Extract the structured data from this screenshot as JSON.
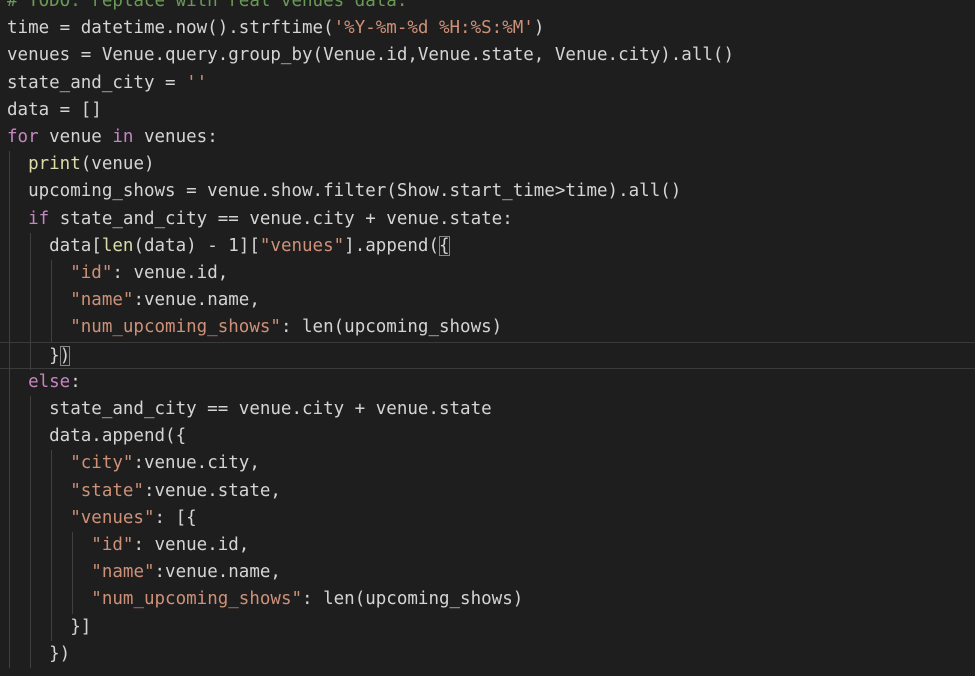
{
  "editor": {
    "lines": [
      [
        {
          "t": "# TODO: replace with real venues data.",
          "c": "cmt"
        }
      ],
      [
        {
          "t": "time = datetime.now().strftime(",
          "c": "var"
        },
        {
          "t": "'%Y-%m-%d %H:%S:%M'",
          "c": "str"
        },
        {
          "t": ")",
          "c": "var"
        }
      ],
      [
        {
          "t": "venues = Venue.query.group_by(Venue.id,Venue.state, Venue.city).all()",
          "c": "var"
        }
      ],
      [
        {
          "t": "state_and_city = ",
          "c": "var"
        },
        {
          "t": "''",
          "c": "str"
        }
      ],
      [
        {
          "t": "data = []",
          "c": "var"
        }
      ],
      [
        {
          "t": "for",
          "c": "kw"
        },
        {
          "t": " venue ",
          "c": "var"
        },
        {
          "t": "in",
          "c": "kw"
        },
        {
          "t": " venues:",
          "c": "var"
        }
      ],
      [
        {
          "t": "  ",
          "c": "var"
        },
        {
          "t": "print",
          "c": "fn"
        },
        {
          "t": "(venue)",
          "c": "var"
        }
      ],
      [
        {
          "t": "  upcoming_shows = venue.show.filter(Show.start_time>time).all()",
          "c": "var"
        }
      ],
      [
        {
          "t": "  ",
          "c": "var"
        },
        {
          "t": "if",
          "c": "kw"
        },
        {
          "t": " state_and_city == venue.city + venue.state:",
          "c": "var"
        }
      ],
      [
        {
          "t": "    data[",
          "c": "var"
        },
        {
          "t": "len",
          "c": "fn"
        },
        {
          "t": "(data) - 1][",
          "c": "var"
        },
        {
          "t": "\"venues\"",
          "c": "str"
        },
        {
          "t": "].append(",
          "c": "var"
        },
        {
          "t": "{",
          "c": "var",
          "m": true
        }
      ],
      [
        {
          "t": "      ",
          "c": "var"
        },
        {
          "t": "\"id\"",
          "c": "str"
        },
        {
          "t": ": venue.id,",
          "c": "var"
        }
      ],
      [
        {
          "t": "      ",
          "c": "var"
        },
        {
          "t": "\"name\"",
          "c": "str"
        },
        {
          "t": ":venue.name,",
          "c": "var"
        }
      ],
      [
        {
          "t": "      ",
          "c": "var"
        },
        {
          "t": "\"num_upcoming_shows\"",
          "c": "str"
        },
        {
          "t": ": len(upcoming_shows)",
          "c": "var"
        }
      ],
      [
        {
          "t": "    }",
          "c": "var"
        },
        {
          "t": ")",
          "c": "var",
          "m": true
        }
      ],
      [
        {
          "t": "  ",
          "c": "var"
        },
        {
          "t": "else",
          "c": "kw"
        },
        {
          "t": ":",
          "c": "var"
        }
      ],
      [
        {
          "t": "    state_and_city == venue.city + venue.state",
          "c": "var"
        }
      ],
      [
        {
          "t": "    data.append({",
          "c": "var"
        }
      ],
      [
        {
          "t": "      ",
          "c": "var"
        },
        {
          "t": "\"city\"",
          "c": "str"
        },
        {
          "t": ":venue.city,",
          "c": "var"
        }
      ],
      [
        {
          "t": "      ",
          "c": "var"
        },
        {
          "t": "\"state\"",
          "c": "str"
        },
        {
          "t": ":venue.state,",
          "c": "var"
        }
      ],
      [
        {
          "t": "      ",
          "c": "var"
        },
        {
          "t": "\"venues\"",
          "c": "str"
        },
        {
          "t": ": [{",
          "c": "var"
        }
      ],
      [
        {
          "t": "        ",
          "c": "var"
        },
        {
          "t": "\"id\"",
          "c": "str"
        },
        {
          "t": ": venue.id,",
          "c": "var"
        }
      ],
      [
        {
          "t": "        ",
          "c": "var"
        },
        {
          "t": "\"name\"",
          "c": "str"
        },
        {
          "t": ":venue.name,",
          "c": "var"
        }
      ],
      [
        {
          "t": "        ",
          "c": "var"
        },
        {
          "t": "\"num_upcoming_shows\"",
          "c": "str"
        },
        {
          "t": ": len(upcoming_shows)",
          "c": "var"
        }
      ],
      [
        {
          "t": "      }]",
          "c": "var"
        }
      ],
      [
        {
          "t": "    })",
          "c": "var"
        }
      ]
    ]
  }
}
